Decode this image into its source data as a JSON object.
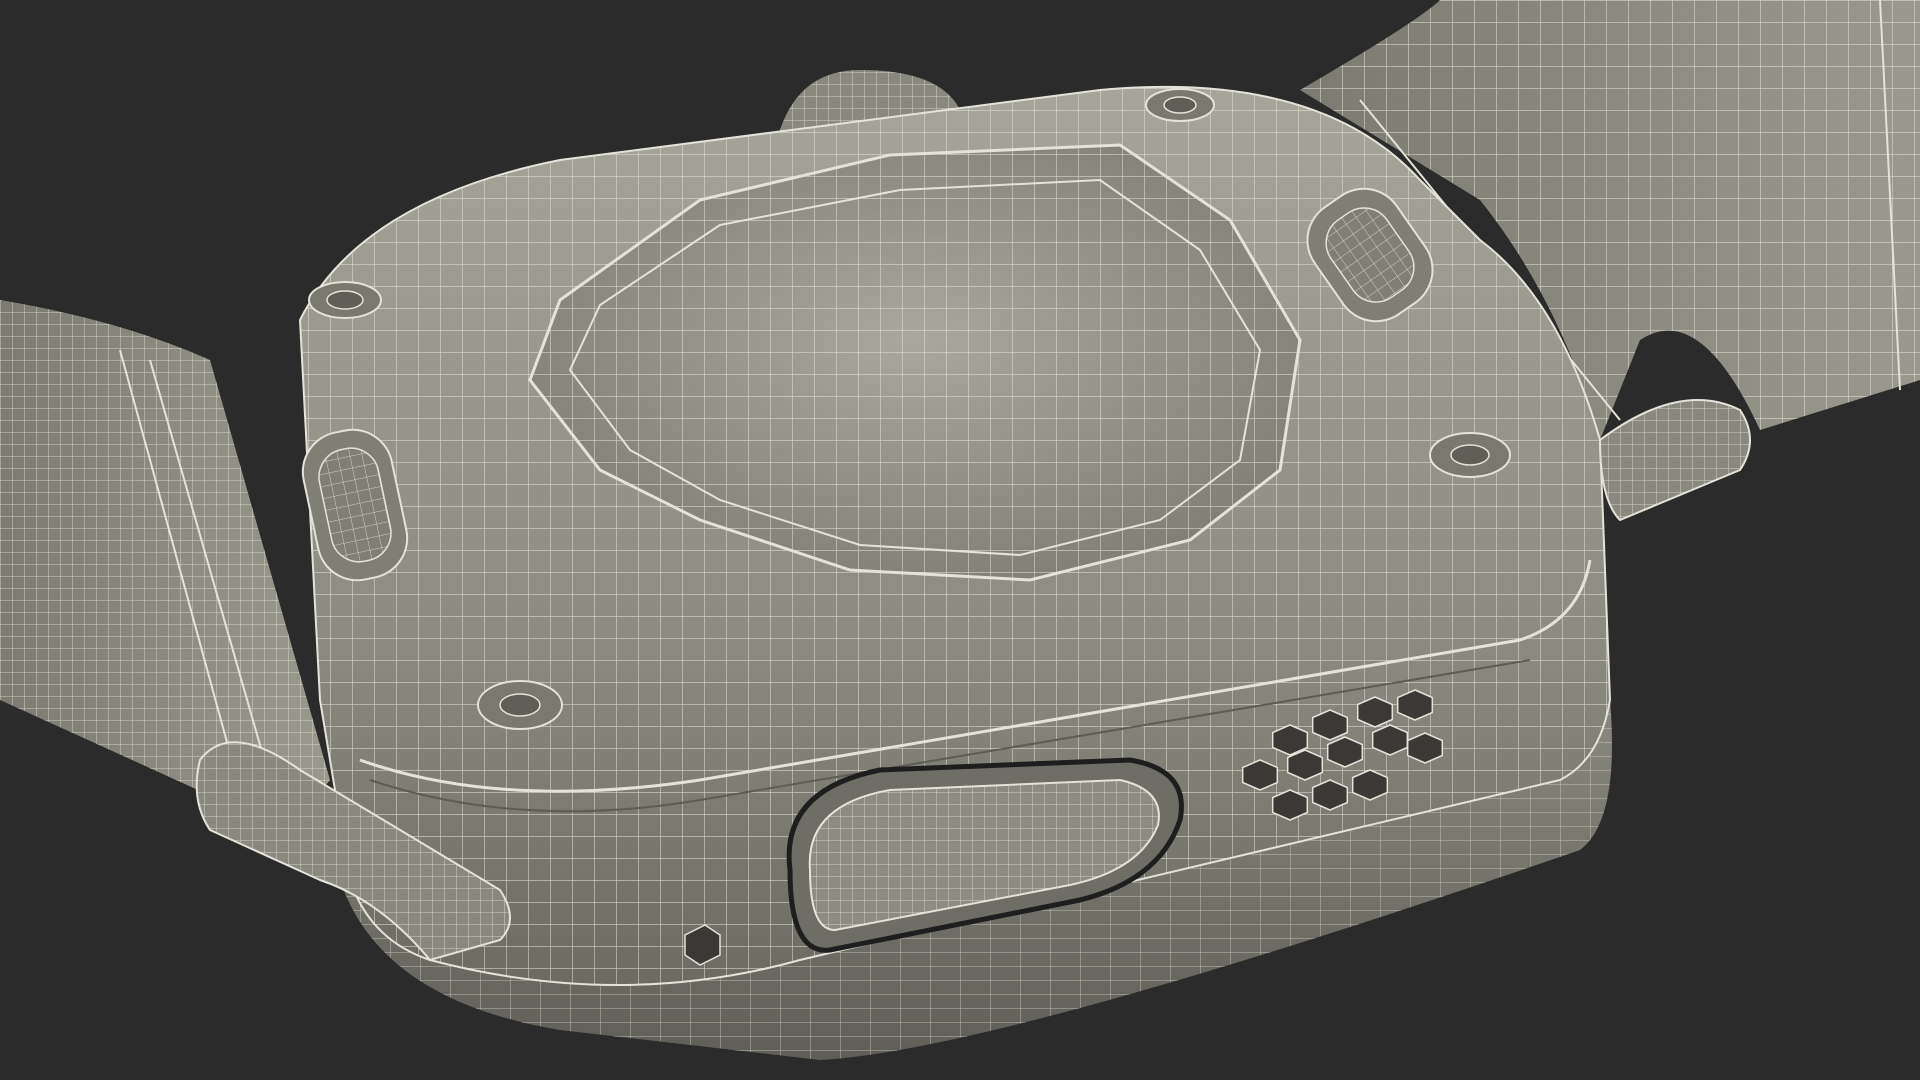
{
  "scene": {
    "subject": "smartwatch-wireframe-underside",
    "colors": {
      "background": "#2b2b2b",
      "surface": "#8f8e84",
      "surface_light": "#a3a297",
      "surface_dark": "#6e6d65",
      "wire": "#e4e3da",
      "wire_dim": "#c9c8bd",
      "shadow": "#1e1e1e",
      "hole": "#3a3935"
    }
  }
}
